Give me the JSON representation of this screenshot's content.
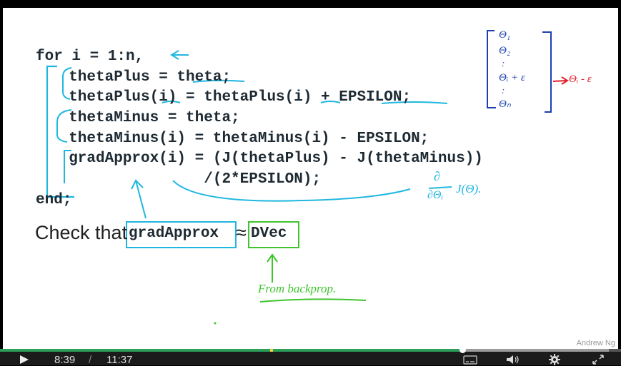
{
  "slide": {
    "code_lines": [
      "for i = 1:n,",
      "  thetaPlus = theta;",
      "  thetaPlus(i) = thetaPlus(i) + EPSILON;",
      "  thetaMinus = theta;",
      "  thetaMinus(i) = thetaMinus(i) - EPSILON;",
      "  gradApprox(i) = (J(thetaPlus) - J(thetaMinus))",
      "                 /(2*EPSILON);",
      "end;"
    ],
    "check_text": "Check that",
    "grad_box": "gradApprox",
    "approx_symbol": "≈",
    "dvec_box": "DVec",
    "annotations": {
      "vector": [
        "Θ₁",
        "Θ₂",
        ":",
        "Θᵢ + ε",
        ":",
        "Θₙ"
      ],
      "theta_minus": "Θᵢ - ε",
      "partial_num": "∂",
      "partial_den": "∂Θᵢ",
      "j_theta": "J(Θ).",
      "from_backprop": "From backprop."
    },
    "watermark": "Andrew Ng"
  },
  "player": {
    "current_time": "8:39",
    "separator": "/",
    "duration": "11:37",
    "played_fraction": 0.745,
    "buffered_fraction": 0.98,
    "marker_fraction": 0.435,
    "icons": [
      "play-icon",
      "captions-icon",
      "volume-icon",
      "settings-icon",
      "fullscreen-icon"
    ]
  },
  "colors": {
    "cyan_ink": "#1fb7e0",
    "green_ink": "#3fc42e",
    "red_ink": "#e0202a",
    "progress": "#2d9d5a"
  }
}
